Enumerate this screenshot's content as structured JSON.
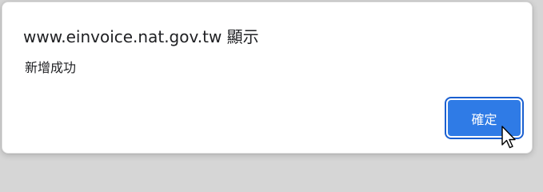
{
  "dialog": {
    "title": "www.einvoice.nat.gov.tw 顯示",
    "message": "新增成功",
    "ok_label": "確定"
  },
  "colors": {
    "accent": "#2f7be6",
    "text": "#202124"
  },
  "icons": {
    "cursor": "arrow-cursor-icon"
  }
}
